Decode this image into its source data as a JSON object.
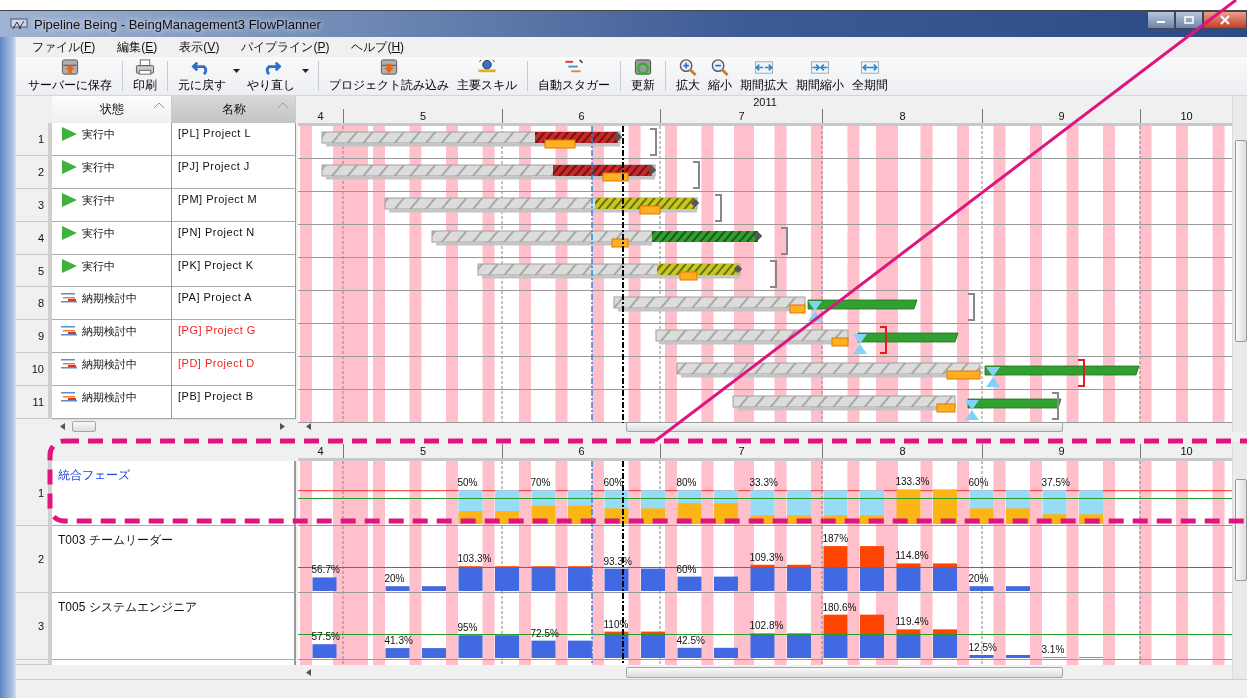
{
  "window": {
    "title": "Pipeline Being - BeingManagement3 FlowPlanner"
  },
  "menu": [
    {
      "before": "ファイル(",
      "key": "F",
      "after": ")"
    },
    {
      "before": "編集(",
      "key": "E",
      "after": ")"
    },
    {
      "before": "表示(",
      "key": "V",
      "after": ")"
    },
    {
      "before": "パイプライン(",
      "key": "P",
      "after": ")"
    },
    {
      "before": "ヘルプ(",
      "key": "H",
      "after": ")"
    }
  ],
  "toolbar": [
    {
      "label": "サーバーに保存",
      "kind": "save"
    },
    {
      "label": "印刷",
      "kind": "print"
    },
    {
      "label": "元に戻す",
      "kind": "undo"
    },
    {
      "kind": "dropdown"
    },
    {
      "label": "やり直し",
      "kind": "redo"
    },
    {
      "kind": "dropdown"
    },
    {
      "label": "プロジェクト読み込み",
      "kind": "load"
    },
    {
      "label": "主要スキル",
      "kind": "skill"
    },
    {
      "label": "自動スタガー",
      "kind": "stagger"
    },
    {
      "label": "更新",
      "kind": "refresh"
    },
    {
      "label": "拡大",
      "kind": "zoom_in"
    },
    {
      "label": "縮小",
      "kind": "zoom_out"
    },
    {
      "label": "期間拡大",
      "kind": "expand"
    },
    {
      "label": "期間縮小",
      "kind": "shrink"
    },
    {
      "label": "全期間",
      "kind": "all"
    }
  ],
  "grid": {
    "columns": [
      {
        "label": "状態",
        "selected": false
      },
      {
        "label": "名称",
        "selected": true
      }
    ],
    "rows": [
      {
        "number": "1",
        "status": "実行中",
        "kind": "running",
        "name": "[PL] Project L",
        "alert": false,
        "color": "#c82828"
      },
      {
        "number": "2",
        "status": "実行中",
        "kind": "running",
        "name": "[PJ] Project  J",
        "alert": false,
        "color": "#c82828"
      },
      {
        "number": "3",
        "status": "実行中",
        "kind": "running",
        "name": "[PM] Project M",
        "alert": false,
        "color": "#c8c820"
      },
      {
        "number": "4",
        "status": "実行中",
        "kind": "running",
        "name": "[PN] Project N",
        "alert": false,
        "color": "#30a030"
      },
      {
        "number": "5",
        "status": "実行中",
        "kind": "running",
        "name": "[PK] Project K",
        "alert": false,
        "color": "#c8c820"
      },
      {
        "number": "8",
        "status": "納期検討中",
        "kind": "review",
        "name": "[PA] Project A",
        "alert": false,
        "color": "#30a030"
      },
      {
        "number": "9",
        "status": "納期検討中",
        "kind": "review",
        "name": "[PG] Project G",
        "alert": true,
        "color": "#30a030"
      },
      {
        "number": "10",
        "status": "納期検討中",
        "kind": "review",
        "name": "[PD] Project D",
        "alert": true,
        "color": "#30a030"
      },
      {
        "number": "11",
        "status": "納期検討中",
        "kind": "review",
        "name": "[PB] Project B",
        "alert": false,
        "color": "#30a030"
      }
    ]
  },
  "timeline": {
    "year": "2011",
    "months": [
      "4",
      "5",
      "6",
      "7",
      "8",
      "9",
      "10"
    ]
  },
  "resources": {
    "months": [
      "4",
      "5",
      "6",
      "7",
      "8",
      "9",
      "10"
    ],
    "rows": [
      {
        "number": "1",
        "name": "統合フェーズ",
        "kind": "phase",
        "labels": [
          "50%",
          "70%",
          "60%",
          "80%",
          "33.3%",
          "133.3%",
          "60%",
          "37.5%"
        ]
      },
      {
        "number": "2",
        "name": "T003 チームリーダー",
        "kind": "member",
        "labels": [
          "56.7%",
          "20%",
          "103.3%",
          "93.3%",
          "60%",
          "109.3%",
          "187%",
          "114.8%",
          "20%"
        ]
      },
      {
        "number": "3",
        "name": "T005 システムエンジニア",
        "kind": "member",
        "labels": [
          "57.5%",
          "41.3%",
          "95%",
          "72.5%",
          "110%",
          "42.5%",
          "102.8%",
          "180.6%",
          "119.4%",
          "12.5%",
          "3.1%"
        ]
      }
    ]
  }
}
